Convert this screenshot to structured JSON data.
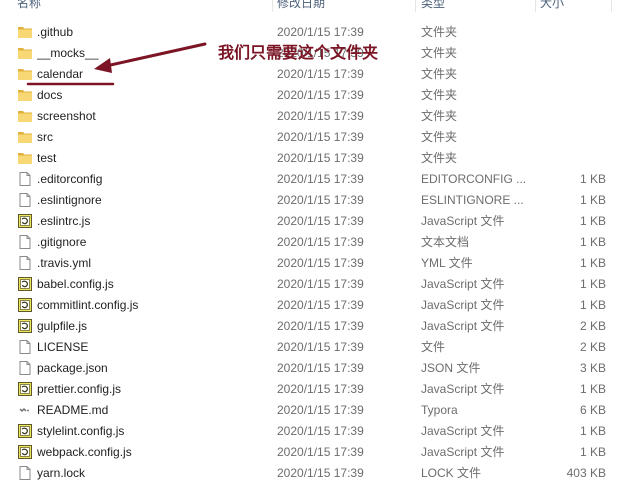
{
  "header": {
    "col_name": "名称",
    "col_date": "修改日期",
    "col_type": "类型",
    "col_size": "大小"
  },
  "annotation": {
    "text": "我们只需要这个文件夹",
    "color": "#7b1424"
  },
  "colors": {
    "folder": "#f8d775",
    "folder_dark": "#e2b33c",
    "annotation": "#7b1424",
    "secondary_text": "#6d6d6d"
  },
  "files": [
    {
      "name": ".github",
      "date": "2020/1/15 17:39",
      "type": "文件夹",
      "size": "",
      "icon": "folder-icon"
    },
    {
      "name": "__mocks__",
      "date": "2020/1/15 17:39",
      "type": "文件夹",
      "size": "",
      "icon": "folder-icon"
    },
    {
      "name": "calendar",
      "date": "2020/1/15 17:39",
      "type": "文件夹",
      "size": "",
      "icon": "folder-icon"
    },
    {
      "name": "docs",
      "date": "2020/1/15 17:39",
      "type": "文件夹",
      "size": "",
      "icon": "folder-icon"
    },
    {
      "name": "screenshot",
      "date": "2020/1/15 17:39",
      "type": "文件夹",
      "size": "",
      "icon": "folder-icon"
    },
    {
      "name": "src",
      "date": "2020/1/15 17:39",
      "type": "文件夹",
      "size": "",
      "icon": "folder-icon"
    },
    {
      "name": "test",
      "date": "2020/1/15 17:39",
      "type": "文件夹",
      "size": "",
      "icon": "folder-icon"
    },
    {
      "name": ".editorconfig",
      "date": "2020/1/15 17:39",
      "type": "EDITORCONFIG ...",
      "size": "1 KB",
      "icon": "blank-file-icon"
    },
    {
      "name": ".eslintignore",
      "date": "2020/1/15 17:39",
      "type": "ESLINTIGNORE ...",
      "size": "1 KB",
      "icon": "blank-file-icon"
    },
    {
      "name": ".eslintrc.js",
      "date": "2020/1/15 17:39",
      "type": "JavaScript 文件",
      "size": "1 KB",
      "icon": "js-file-icon"
    },
    {
      "name": ".gitignore",
      "date": "2020/1/15 17:39",
      "type": "文本文档",
      "size": "1 KB",
      "icon": "blank-file-icon"
    },
    {
      "name": ".travis.yml",
      "date": "2020/1/15 17:39",
      "type": "YML 文件",
      "size": "1 KB",
      "icon": "blank-file-icon"
    },
    {
      "name": "babel.config.js",
      "date": "2020/1/15 17:39",
      "type": "JavaScript 文件",
      "size": "1 KB",
      "icon": "js-file-icon"
    },
    {
      "name": "commitlint.config.js",
      "date": "2020/1/15 17:39",
      "type": "JavaScript 文件",
      "size": "1 KB",
      "icon": "js-file-icon"
    },
    {
      "name": "gulpfile.js",
      "date": "2020/1/15 17:39",
      "type": "JavaScript 文件",
      "size": "2 KB",
      "icon": "js-file-icon"
    },
    {
      "name": "LICENSE",
      "date": "2020/1/15 17:39",
      "type": "文件",
      "size": "2 KB",
      "icon": "blank-file-icon"
    },
    {
      "name": "package.json",
      "date": "2020/1/15 17:39",
      "type": "JSON 文件",
      "size": "3 KB",
      "icon": "blank-file-icon"
    },
    {
      "name": "prettier.config.js",
      "date": "2020/1/15 17:39",
      "type": "JavaScript 文件",
      "size": "1 KB",
      "icon": "js-file-icon"
    },
    {
      "name": "README.md",
      "date": "2020/1/15 17:39",
      "type": "Typora",
      "size": "6 KB",
      "icon": "markdown-file-icon"
    },
    {
      "name": "stylelint.config.js",
      "date": "2020/1/15 17:39",
      "type": "JavaScript 文件",
      "size": "1 KB",
      "icon": "js-file-icon"
    },
    {
      "name": "webpack.config.js",
      "date": "2020/1/15 17:39",
      "type": "JavaScript 文件",
      "size": "1 KB",
      "icon": "js-file-icon"
    },
    {
      "name": "yarn.lock",
      "date": "2020/1/15 17:39",
      "type": "LOCK 文件",
      "size": "403 KB",
      "icon": "blank-file-icon"
    }
  ]
}
